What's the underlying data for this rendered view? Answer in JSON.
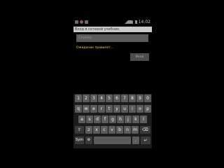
{
  "status_bar": {
    "time": "14:02"
  },
  "title_bar": {
    "title": "Вход в сетевой учебник"
  },
  "input": {
    "value": "Сервер"
  },
  "status_message": "Ожидание правилет...",
  "enter_button": {
    "label": "Вход"
  },
  "keyboard": {
    "row1": [
      "1",
      "2",
      "3",
      "4",
      "5",
      "6",
      "7",
      "8",
      "9",
      "0"
    ],
    "row2": [
      "q",
      "w",
      "e",
      "r",
      "t",
      "y",
      "u",
      "i",
      "o",
      "p"
    ],
    "row3": [
      "a",
      "s",
      "d",
      "f",
      "g",
      "h",
      "j",
      "k",
      "l"
    ],
    "row4": {
      "shift": "⇧",
      "letters": [
        "z",
        "x",
        "c",
        "v",
        "b",
        "n",
        "m"
      ],
      "backspace": "⌫"
    },
    "row5": {
      "sym": "Sym",
      "settings": "⚙",
      "space": "",
      "dot": ".",
      "enter": "↵"
    }
  },
  "icons": {
    "status_left": [
      "notification-icon",
      "alarm-icon",
      "usb-icon"
    ],
    "status_right": [
      "signal-icon",
      "wifi-icon",
      "battery-icon"
    ]
  }
}
